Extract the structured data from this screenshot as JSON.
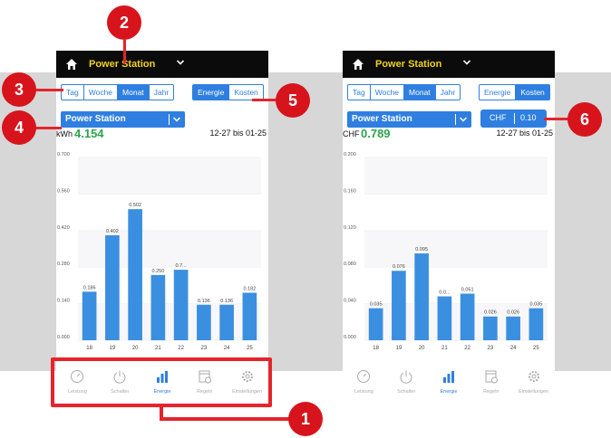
{
  "screens": [
    {
      "station_title": "Power Station",
      "period_tabs": [
        {
          "label": "Tag",
          "active": false
        },
        {
          "label": "Woche",
          "active": false
        },
        {
          "label": "Monat",
          "active": true
        },
        {
          "label": "Jahr",
          "active": false
        }
      ],
      "mode_tabs": [
        {
          "label": "Energie",
          "active": true
        },
        {
          "label": "Kosten",
          "active": false
        }
      ],
      "device_select": "Power Station",
      "total_unit": "kWh",
      "total_value": "4.154",
      "date_range": "12-27 bis 01-25",
      "chart": {
        "y_ticks": [
          "0.700",
          "0.560",
          "0.420",
          "0.280",
          "0.140",
          "0.000"
        ],
        "ylim": [
          0,
          0.7
        ],
        "x_labels": [
          "18",
          "19",
          "20",
          "21",
          "22",
          "23",
          "24",
          "25"
        ],
        "values": [
          0.186,
          0.402,
          0.502,
          0.25,
          0.27,
          0.136,
          0.136,
          0.182
        ],
        "value_labels": [
          "0.186",
          "0.402",
          "0.502",
          "0.250",
          "0.7...",
          "0.136",
          "0.136",
          "0.182"
        ]
      }
    },
    {
      "station_title": "Power Station",
      "period_tabs": [
        {
          "label": "Tag",
          "active": false
        },
        {
          "label": "Woche",
          "active": false
        },
        {
          "label": "Monat",
          "active": true
        },
        {
          "label": "Jahr",
          "active": false
        }
      ],
      "mode_tabs": [
        {
          "label": "Energie",
          "active": false
        },
        {
          "label": "Kosten",
          "active": true
        }
      ],
      "device_select": "Power Station",
      "price_currency": "CHF",
      "price_value": "0.10",
      "total_unit": "CHF",
      "total_value": "0.789",
      "date_range": "12-27 bis 01-25",
      "chart": {
        "y_ticks": [
          "0.200",
          "0.160",
          "0.120",
          "0.080",
          "0.040",
          "0.000"
        ],
        "ylim": [
          0,
          0.2
        ],
        "x_labels": [
          "18",
          "19",
          "20",
          "21",
          "22",
          "23",
          "24",
          "25"
        ],
        "values": [
          0.035,
          0.076,
          0.095,
          0.048,
          0.051,
          0.026,
          0.026,
          0.035
        ],
        "value_labels": [
          "0.035",
          "0.076",
          "0.095",
          "0.0...",
          "0.051",
          "0.026",
          "0.026",
          "0.035"
        ]
      }
    }
  ],
  "nav_items": [
    {
      "label": "Leistung",
      "icon": "gauge-icon",
      "active": false
    },
    {
      "label": "Schalter",
      "icon": "power-icon",
      "active": false
    },
    {
      "label": "Energie",
      "icon": "bar-chart-icon",
      "active": true
    },
    {
      "label": "Regeln",
      "icon": "calendar-clock-icon",
      "active": false
    },
    {
      "label": "Einstellungen",
      "icon": "gear-icon",
      "active": false
    }
  ],
  "callouts": [
    "1",
    "2",
    "3",
    "4",
    "5",
    "6"
  ],
  "colors": {
    "accent_blue": "#2f7fe0",
    "bar_blue": "#3b8fe0",
    "title_yellow": "#f3d21a",
    "total_green": "#2aa44a",
    "callout_red": "#d7141c"
  }
}
